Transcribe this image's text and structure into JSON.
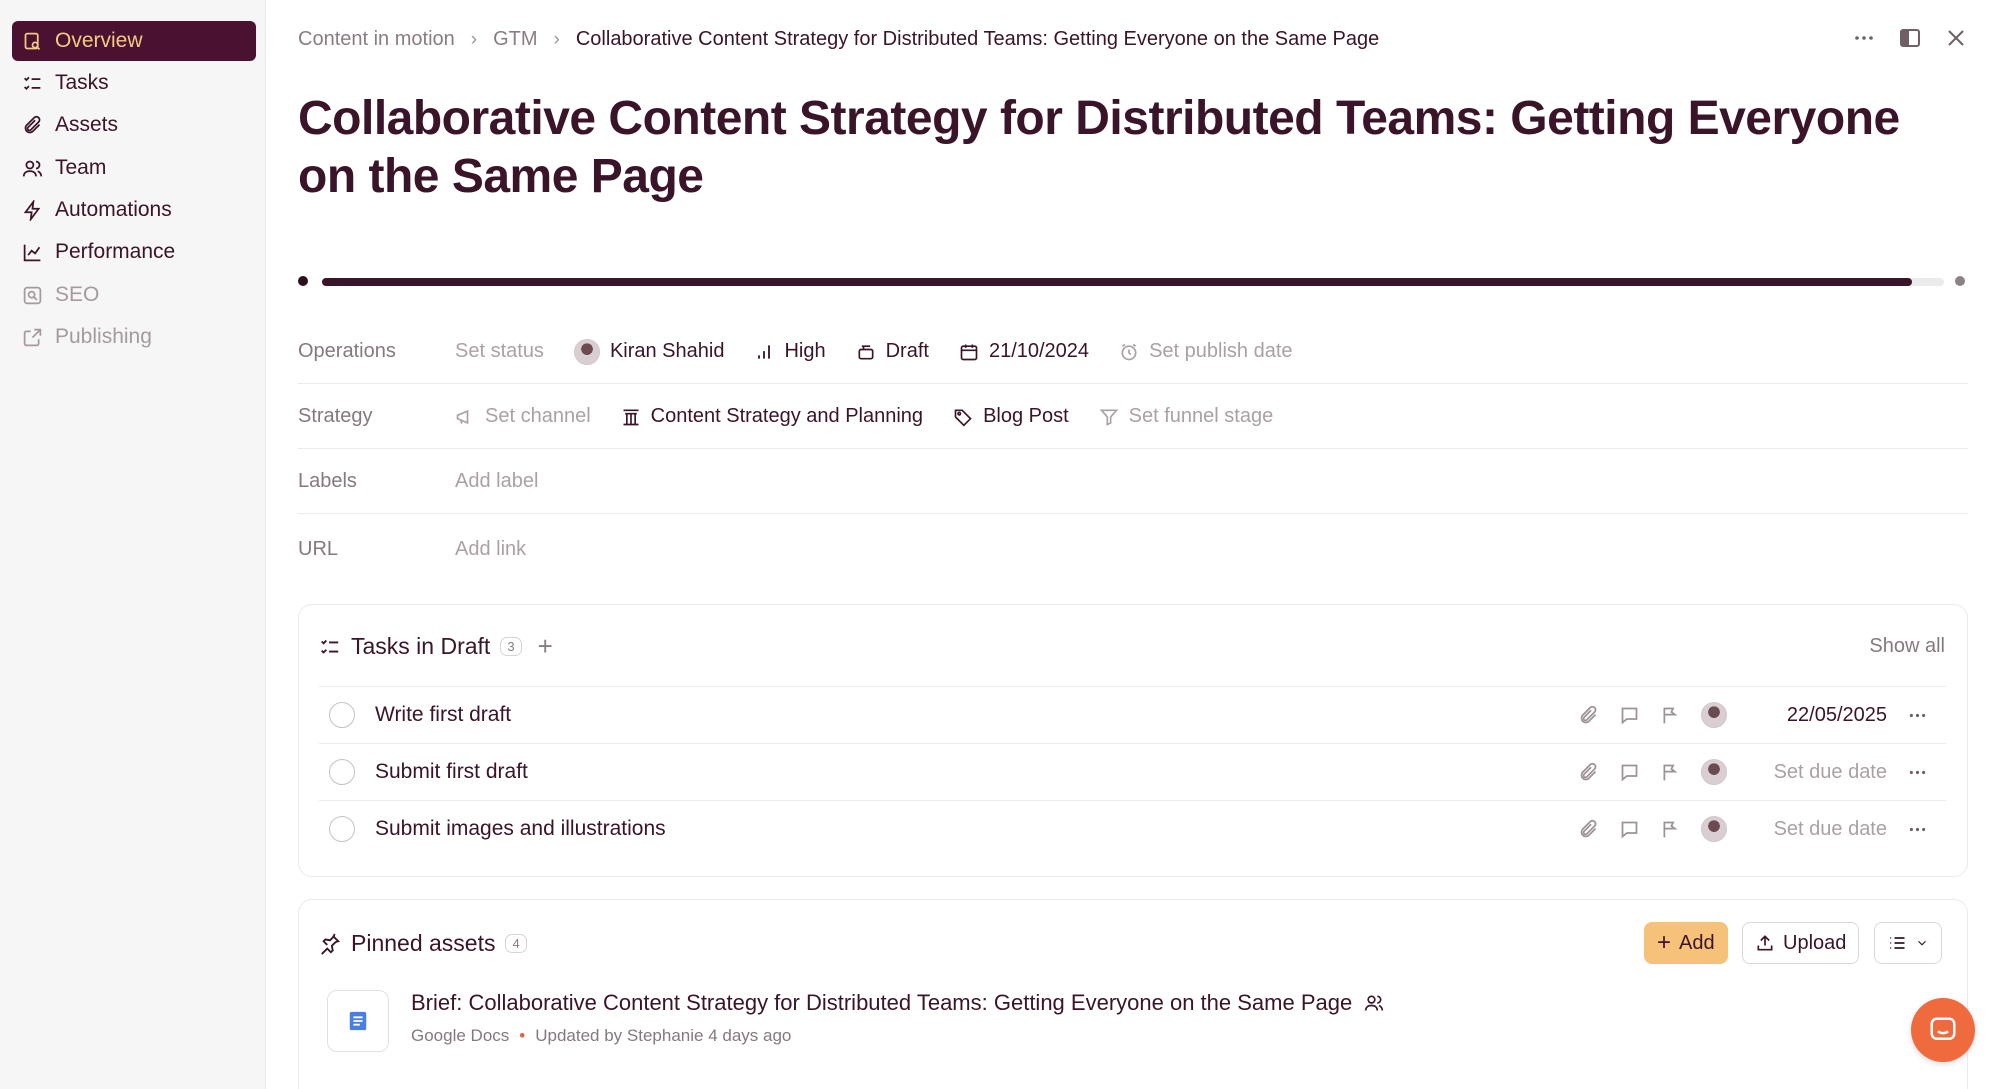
{
  "sidebar": {
    "items": [
      {
        "label": "Overview",
        "icon": "overview-icon",
        "active": true
      },
      {
        "label": "Tasks",
        "icon": "tasks-icon"
      },
      {
        "label": "Assets",
        "icon": "paperclip-icon"
      },
      {
        "label": "Team",
        "icon": "team-icon"
      },
      {
        "label": "Automations",
        "icon": "bolt-icon"
      },
      {
        "label": "Performance",
        "icon": "chart-icon"
      },
      {
        "label": "SEO",
        "icon": "seo-icon",
        "disabled": true
      },
      {
        "label": "Publishing",
        "icon": "publish-icon",
        "disabled": true
      }
    ]
  },
  "breadcrumb": {
    "items": [
      "Content in motion",
      "GTM",
      "Collaborative Content Strategy for Distributed Teams: Getting Everyone on the Same Page"
    ]
  },
  "page": {
    "title": "Collaborative Content Strategy for Distributed Teams: Getting Everyone on the Same Page",
    "progress": 0.98
  },
  "properties": {
    "operations": {
      "label": "Operations",
      "status": "Set status",
      "assignee": "Kiran Shahid",
      "priority": "High",
      "stage": "Draft",
      "date": "21/10/2024",
      "publish_date": "Set publish date"
    },
    "strategy": {
      "label": "Strategy",
      "channel": "Set channel",
      "pillar": "Content Strategy and Planning",
      "type": "Blog Post",
      "funnel": "Set funnel stage"
    },
    "labels": {
      "label": "Labels",
      "placeholder": "Add label"
    },
    "url": {
      "label": "URL",
      "placeholder": "Add link"
    }
  },
  "tasks": {
    "title": "Tasks in Draft",
    "count": "3",
    "show_all": "Show all",
    "items": [
      {
        "title": "Write first draft",
        "due": "22/05/2025"
      },
      {
        "title": "Submit first draft",
        "due": "Set due date"
      },
      {
        "title": "Submit images and illustrations",
        "due": "Set due date"
      }
    ]
  },
  "pinned": {
    "title": "Pinned assets",
    "count": "4",
    "add_label": "Add",
    "upload_label": "Upload",
    "asset": {
      "title": "Brief: Collaborative Content Strategy for Distributed Teams: Getting Everyone on the Same Page",
      "source": "Google Docs",
      "updated": "Updated by Stephanie 4 days ago"
    }
  },
  "colors": {
    "accent_dark": "#4a1130",
    "accent_gold": "#f4c986",
    "add_button": "#f6c27a",
    "chat_button": "#ef6a3c"
  }
}
